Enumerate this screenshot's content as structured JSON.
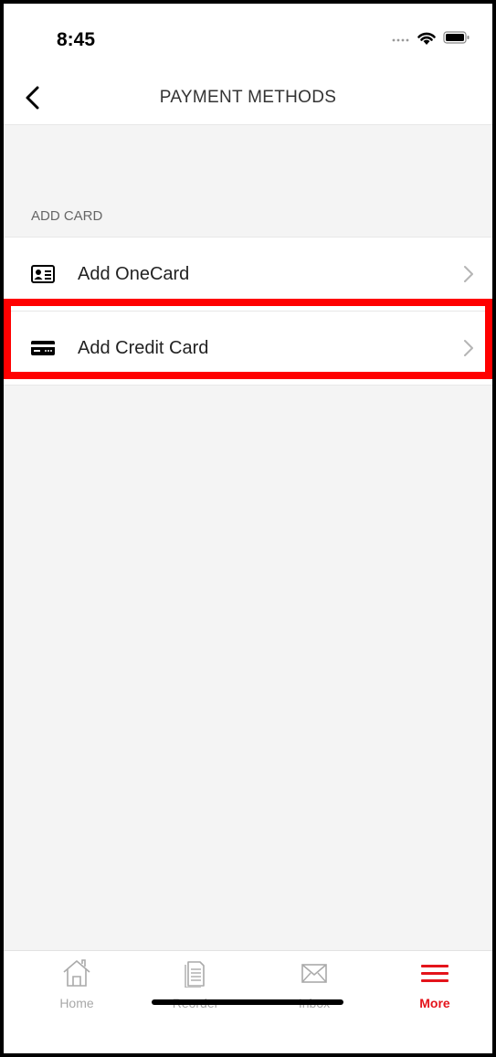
{
  "status_bar": {
    "time": "8:45"
  },
  "header": {
    "title": "PAYMENT METHODS"
  },
  "section": {
    "header": "ADD CARD",
    "items": [
      {
        "label": "Add OneCard",
        "icon": "id-card-icon"
      },
      {
        "label": "Add Credit Card",
        "icon": "credit-card-icon"
      }
    ]
  },
  "tabs": [
    {
      "label": "Home",
      "icon": "home-icon",
      "active": false
    },
    {
      "label": "Reorder",
      "icon": "receipt-icon",
      "active": false
    },
    {
      "label": "Inbox",
      "icon": "mail-icon",
      "active": false
    },
    {
      "label": "More",
      "icon": "menu-icon",
      "active": true
    }
  ],
  "colors": {
    "accent": "#e4141b",
    "highlight": "#ff0000",
    "background": "#f4f4f4"
  }
}
